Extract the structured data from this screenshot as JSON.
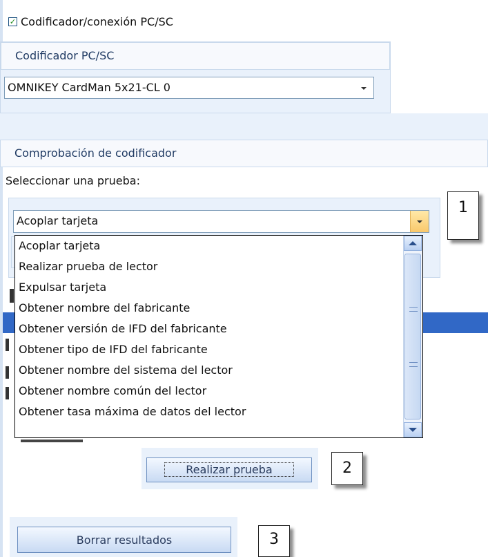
{
  "connection": {
    "checkbox_label": "Codificador/conexión PC/SC",
    "checked": true
  },
  "pcsc_group": {
    "title": "Codificador PC/SC",
    "encoder_value": "OMNIKEY CardMan 5x21-CL 0"
  },
  "test_group": {
    "title": "Comprobación de codificador",
    "select_label": "Seleccionar una prueba:",
    "selected_test": "Acoplar tarjeta",
    "options": [
      "Acoplar tarjeta",
      "Realizar prueba de lector",
      "Expulsar tarjeta",
      "Obtener nombre del fabricante",
      "Obtener versión de IFD del fabricante",
      "Obtener tipo de IFD del fabricante",
      "Obtener nombre del sistema del lector",
      "Obtener nombre común del lector",
      "Obtener tasa máxima de datos del lector"
    ],
    "run_button": "Realizar prueba",
    "clear_button": "Borrar resultados"
  },
  "callouts": {
    "one": "1",
    "two": "2",
    "three": "3"
  },
  "colors": {
    "selection": "#3168c6",
    "pane": "#e9f1fb",
    "header_text": "#1f3a63"
  }
}
